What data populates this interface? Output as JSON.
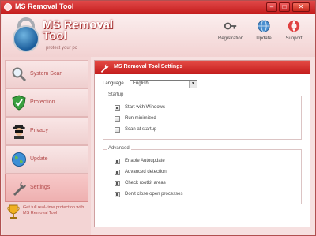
{
  "window": {
    "title": "MS Removal Tool"
  },
  "header": {
    "app_name_line1": "MS Removal",
    "app_name_line2": "Tool",
    "tagline": "protect your pc",
    "tools": [
      {
        "label": "Registration",
        "icon": "key-icon"
      },
      {
        "label": "Update",
        "icon": "globe-icon"
      },
      {
        "label": "Support",
        "icon": "lifebuoy-icon"
      }
    ]
  },
  "sidebar": {
    "items": [
      {
        "label": "System Scan",
        "icon": "magnifier-icon"
      },
      {
        "label": "Protection",
        "icon": "shield-check-icon"
      },
      {
        "label": "Privacy",
        "icon": "spy-icon"
      },
      {
        "label": "Update",
        "icon": "globe-icon"
      },
      {
        "label": "Settings",
        "icon": "wrench-icon",
        "active": true
      }
    ],
    "promo": "Get full real-time protection with MS Removal Tool"
  },
  "settings": {
    "title": "MS Removal Tool Settings",
    "language_label": "Language",
    "language_value": "English",
    "startup_group": "Startup",
    "startup_options": [
      {
        "label": "Start with Windows",
        "checked": true
      },
      {
        "label": "Run minimized",
        "checked": false
      },
      {
        "label": "Scan at startup",
        "checked": false
      }
    ],
    "advanced_group": "Advanced",
    "advanced_options": [
      {
        "label": "Enable Autoupdate",
        "checked": true
      },
      {
        "label": "Advanced detection",
        "checked": true
      },
      {
        "label": "Check rootkit areas",
        "checked": true
      },
      {
        "label": "Don't close open processes",
        "checked": true
      }
    ]
  },
  "colors": {
    "accent": "#c41c1c",
    "sidebar_text": "#b34a4a",
    "background": "#f6e0e0"
  }
}
